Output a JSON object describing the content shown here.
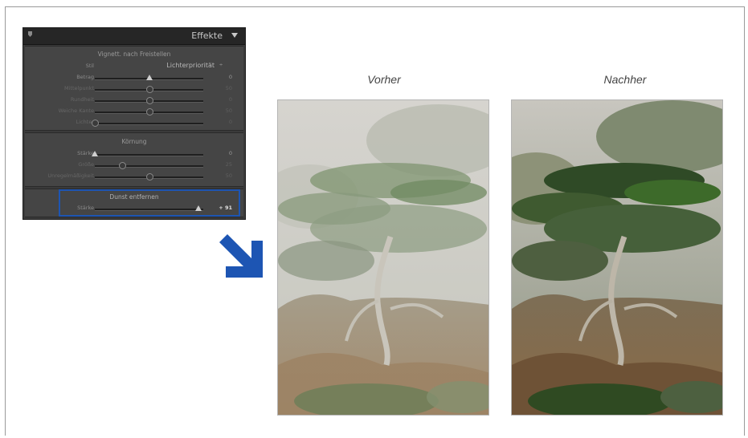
{
  "panel": {
    "title": "Effekte",
    "vignette": {
      "title": "Vignett. nach Freistellen",
      "style_label": "Stil",
      "style_value": "Lichterpriorität",
      "style_arrows": "÷",
      "sliders": [
        {
          "label": "Betrag",
          "value": "0",
          "dim": false,
          "thumb": "triangle",
          "pos": 0.5
        },
        {
          "label": "Mittelpunkt",
          "value": "50",
          "dim": true,
          "thumb": "round",
          "pos": 0.5
        },
        {
          "label": "Rundheit",
          "value": "0",
          "dim": true,
          "thumb": "round",
          "pos": 0.5
        },
        {
          "label": "Weiche Kante",
          "value": "50",
          "dim": true,
          "thumb": "round",
          "pos": 0.5
        },
        {
          "label": "Lichter",
          "value": "0",
          "dim": true,
          "thumb": "round",
          "pos": 0.0
        }
      ]
    },
    "grain": {
      "title": "Körnung",
      "sliders": [
        {
          "label": "Stärke",
          "value": "0",
          "dim": false,
          "thumb": "triangle",
          "pos": 0.0
        },
        {
          "label": "Größe",
          "value": "25",
          "dim": true,
          "thumb": "round",
          "pos": 0.25
        },
        {
          "label": "Unregelmäßigkeit",
          "value": "50",
          "dim": true,
          "thumb": "round",
          "pos": 0.5
        }
      ]
    },
    "dehaze": {
      "title": "Dunst entfernen",
      "sliders": [
        {
          "label": "Stärke",
          "value": "+ 91",
          "dim": false,
          "thumb": "triangle",
          "pos": 0.955
        }
      ]
    }
  },
  "comparison": {
    "before_label": "Vorher",
    "after_label": "Nachher"
  },
  "colors": {
    "highlight": "#1d55b3",
    "arrow": "#1d55b3"
  }
}
